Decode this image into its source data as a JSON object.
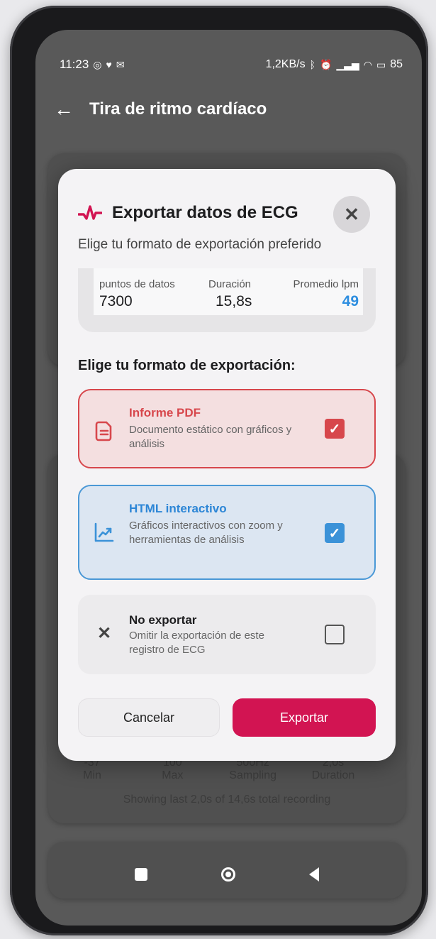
{
  "status_bar": {
    "time": "11:23",
    "network_speed": "1,2KB/s",
    "battery": "85"
  },
  "app_bar": {
    "title": "Tira de ritmo cardíaco"
  },
  "background": {
    "stats": [
      {
        "value": "-37",
        "label": "Min"
      },
      {
        "value": "100",
        "label": "Max"
      },
      {
        "value": "500Hz",
        "label": "Sampling"
      },
      {
        "value": "2,0s",
        "label": "Duration"
      }
    ],
    "note": "Showing last 2,0s of 14,6s total recording"
  },
  "dialog": {
    "title": "Exportar datos de ECG",
    "subtitle": "Elige tu formato de exportación preferido",
    "info": {
      "points_label": "puntos de datos",
      "points_value": "7300",
      "duration_label": "Duración",
      "duration_value": "15,8s",
      "bpm_label": "Promedio lpm",
      "bpm_value": "49"
    },
    "section_title": "Elige tu formato de exportación:",
    "options": [
      {
        "title": "Informe PDF",
        "desc": "Documento estático con gráficos y análisis",
        "checked": true
      },
      {
        "title": "HTML interactivo",
        "desc": "Gráficos interactivos con zoom y herramientas de análisis",
        "checked": true
      },
      {
        "title": "No exportar",
        "desc": "Omitir la exportación de este registro de ECG",
        "checked": false
      }
    ],
    "cancel_label": "Cancelar",
    "export_label": "Exportar"
  },
  "colors": {
    "accent_red": "#d21452",
    "pdf_border": "#d7474c",
    "html_border": "#4a98d6",
    "bpm_blue": "#2d8ee0"
  },
  "icons": [
    "whatsapp-icon",
    "heart-icon",
    "mail-icon",
    "bluetooth-icon",
    "alarm-icon",
    "signal-icon",
    "wifi-icon",
    "battery-icon",
    "back-arrow-icon",
    "pulse-icon",
    "close-icon",
    "document-icon",
    "chart-icon",
    "x-icon",
    "check-icon"
  ]
}
